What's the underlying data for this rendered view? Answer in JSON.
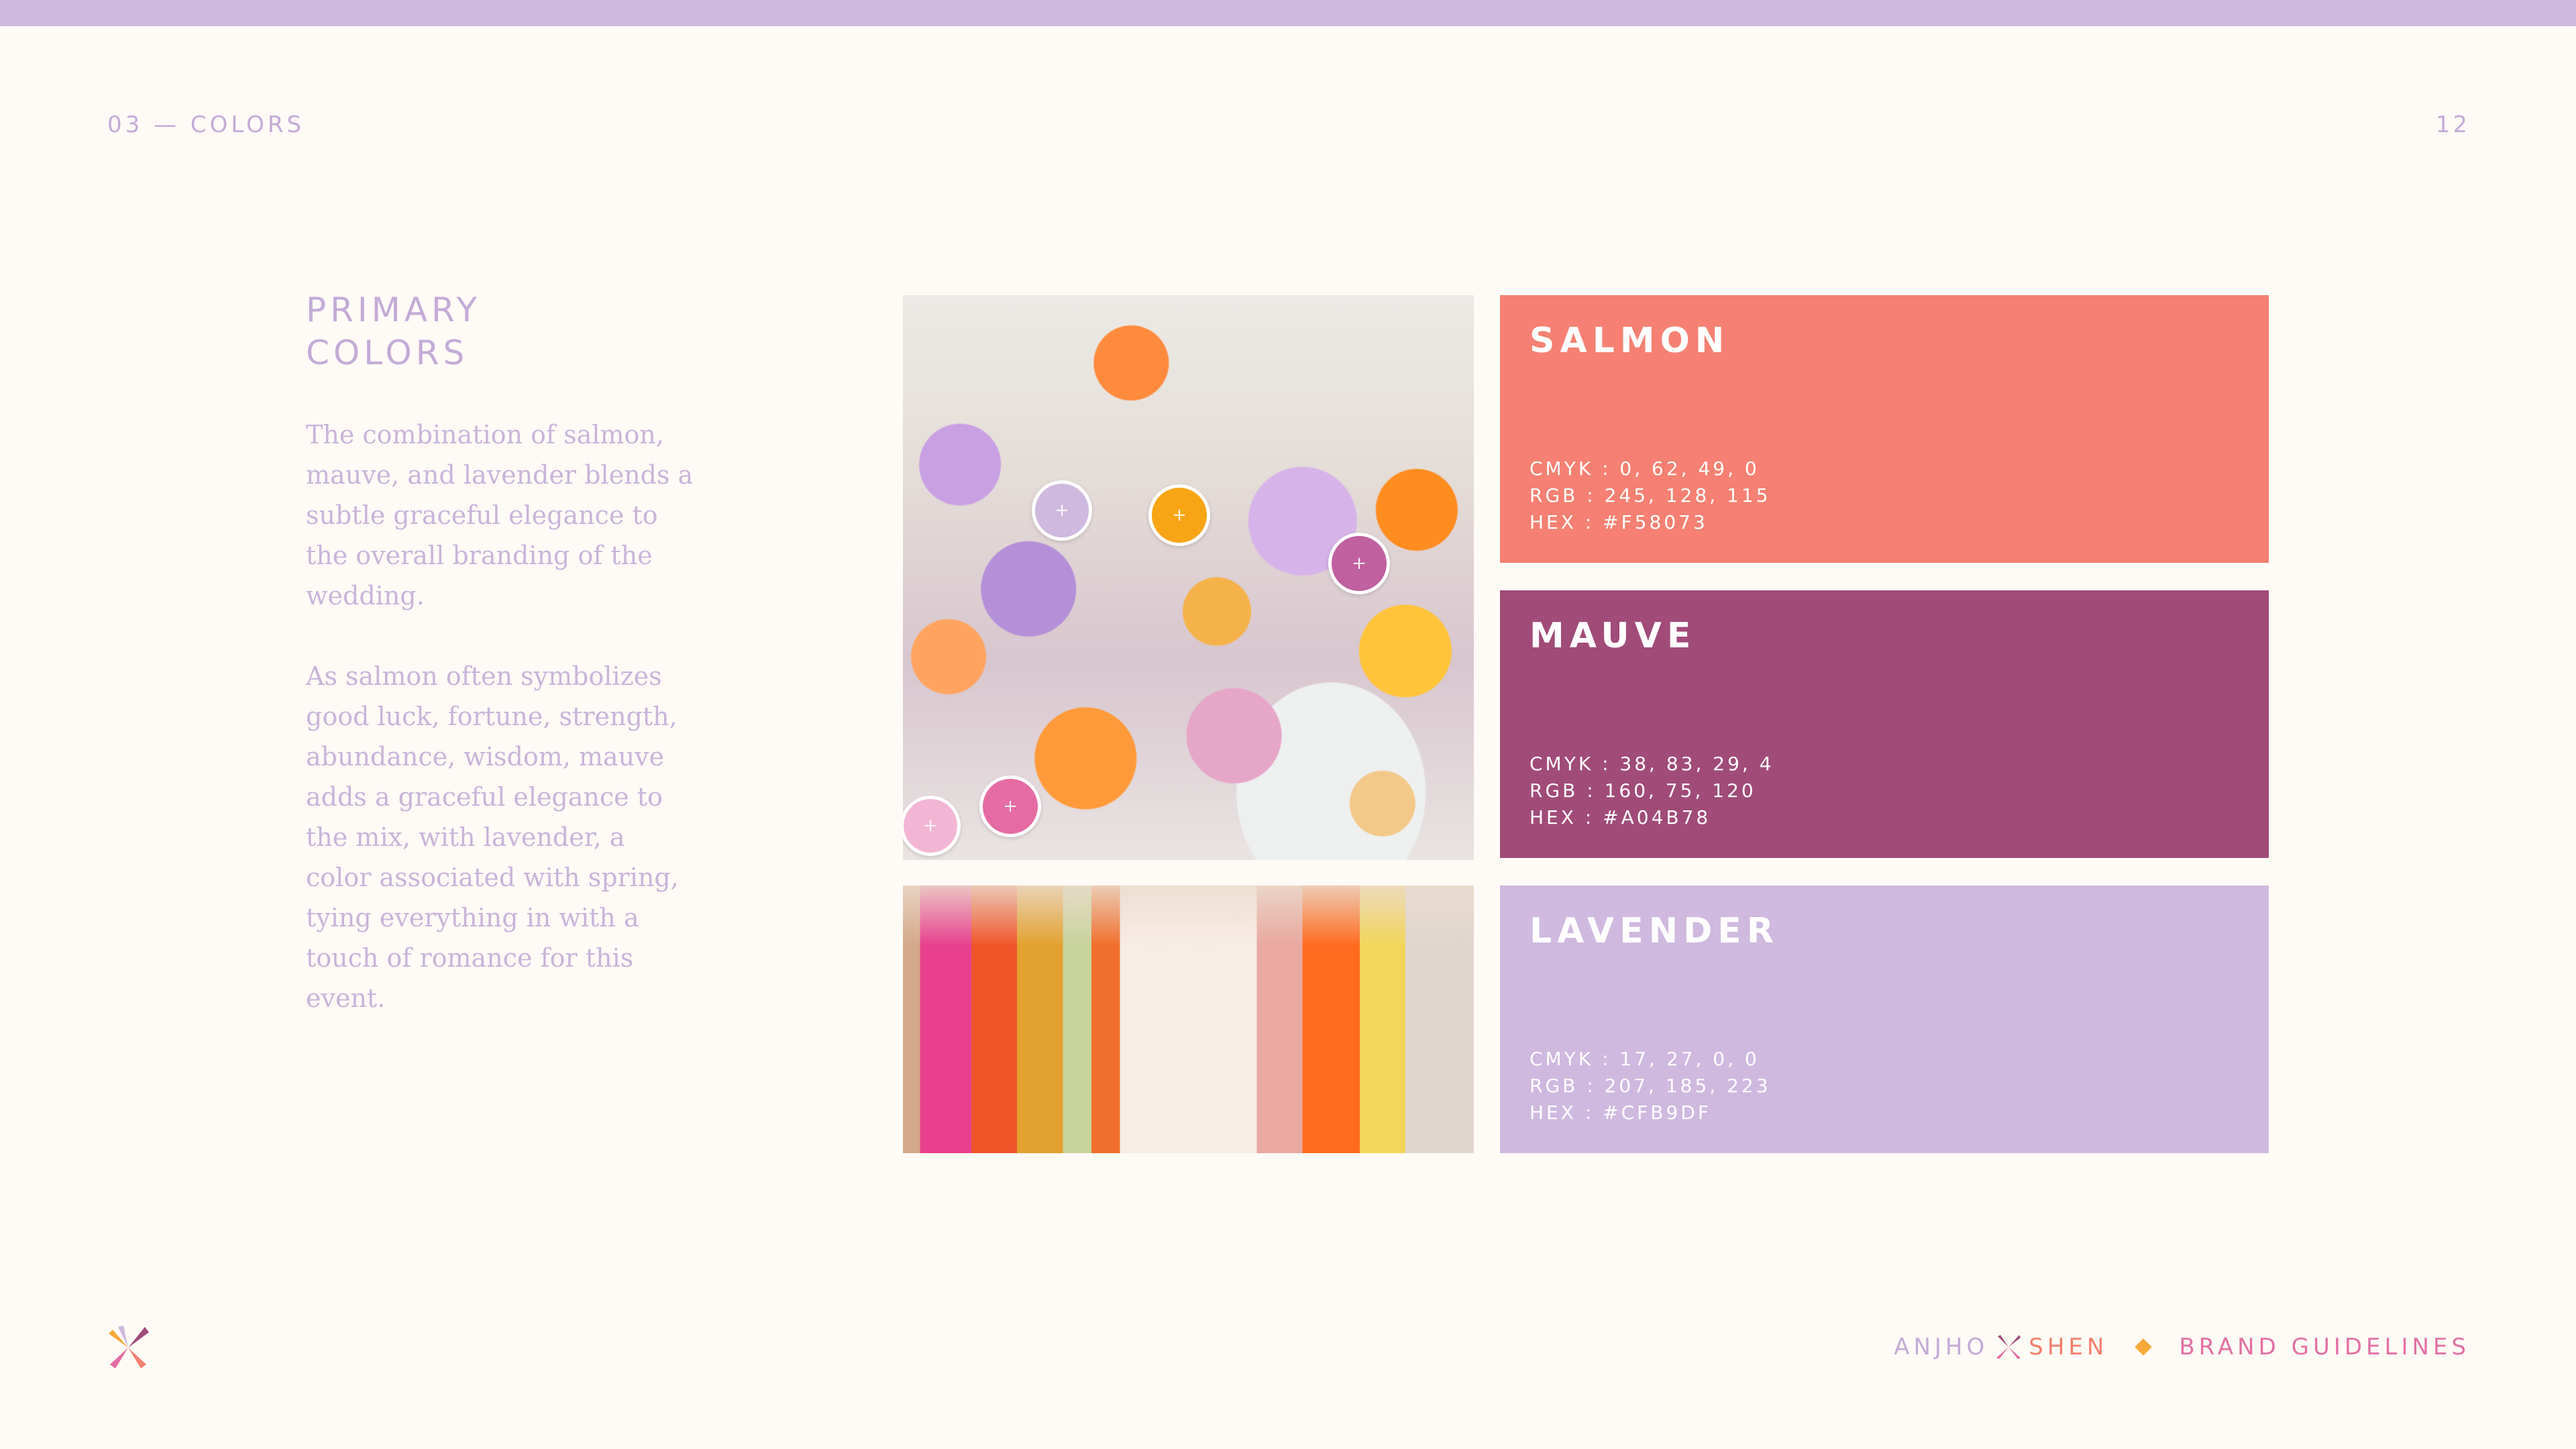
{
  "colors": {
    "bar": "#CFB9DF",
    "accent": "#C3ABD6"
  },
  "header": {
    "section": "03 — COLORS",
    "page_number": "12"
  },
  "intro": {
    "title_line1": "PRIMARY",
    "title_line2": "COLORS",
    "paragraph1": "The combination of salmon, mauve, and lavender blends a subtle graceful elegance to the overall branding of the wedding.",
    "paragraph2": "As salmon often symbolizes good luck, fortune, strength, abundance, wisdom, mauve adds a graceful elegance to the mix, with lavender, a color associated with spring, tying everything in with a touch of romance for this event."
  },
  "photos": [
    {
      "subject": "floral-arrangement",
      "icon": "photo-flowers"
    },
    {
      "subject": "bridal-party-dresses",
      "icon": "photo-bridal-party"
    }
  ],
  "color_pickers": [
    {
      "color": "#CFB9DF",
      "icon": "plus-icon"
    },
    {
      "color": "#F7A515",
      "icon": "plus-icon"
    },
    {
      "color": "#C0609F",
      "icon": "plus-icon"
    },
    {
      "color": "#F2B6D4",
      "icon": "plus-icon"
    },
    {
      "color": "#E56BA3",
      "icon": "plus-icon"
    }
  ],
  "swatches": [
    {
      "name": "SALMON",
      "hex_value": "#F58073",
      "cmyk": "CMYK : 0, 62, 49, 0",
      "rgb": "RGB : 245, 128, 115",
      "hex": "HEX : #F58073"
    },
    {
      "name": "MAUVE",
      "hex_value": "#A04B78",
      "cmyk": "CMYK : 38, 83, 29, 4",
      "rgb": "RGB : 160, 75, 120",
      "hex": "HEX : #A04B78"
    },
    {
      "name": "LAVENDER",
      "hex_value": "#CFB9DF",
      "cmyk": "CMYK : 17, 27, 0, 0",
      "rgb": "RGB : 207, 185, 223",
      "hex": "HEX : #CFB9DF"
    }
  ],
  "footer": {
    "brand_first": "ANJHO",
    "brand_second": "SHEN",
    "doc_title": "BRAND GUIDELINES",
    "logo_icon": "brand-mark-icon",
    "separator_icon": "diamond-icon"
  }
}
